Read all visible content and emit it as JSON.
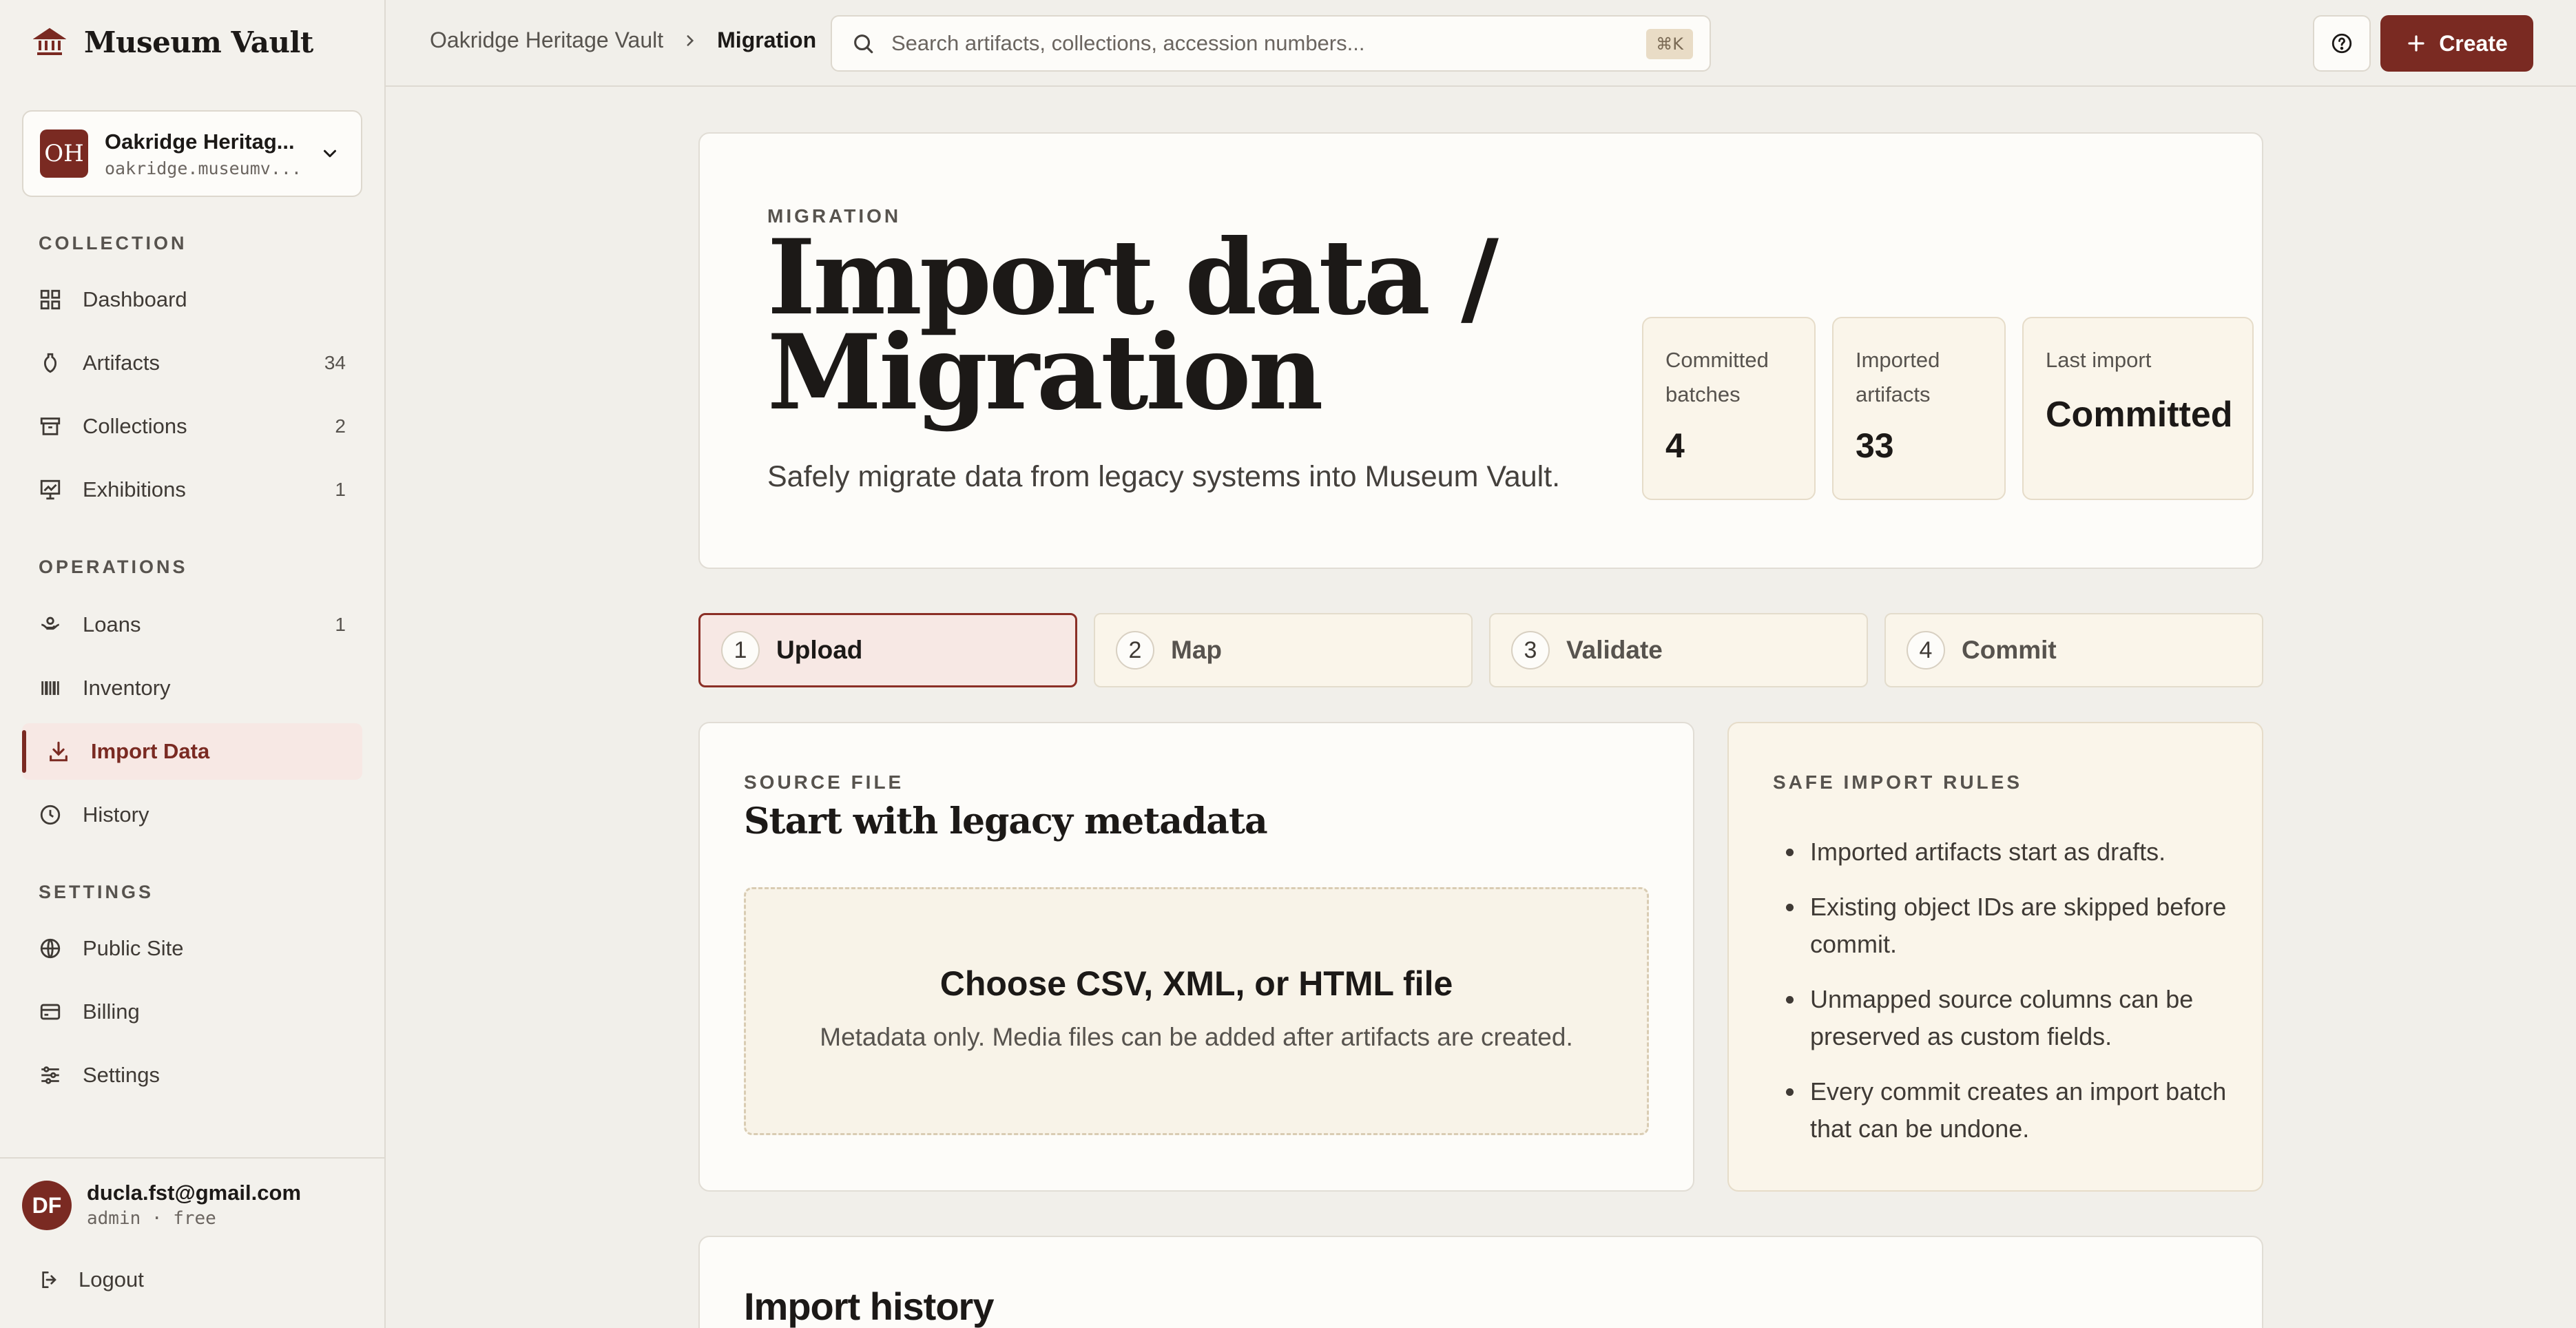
{
  "app": {
    "name": "Museum Vault"
  },
  "org": {
    "initials": "OH",
    "name": "Oakridge Heritag...",
    "domain": "oakridge.museumv..."
  },
  "sidebar": {
    "sections": [
      {
        "title": "COLLECTION"
      },
      {
        "title": "OPERATIONS"
      },
      {
        "title": "SETTINGS"
      }
    ],
    "items": [
      {
        "label": "Dashboard",
        "icon": "grid-icon",
        "count": ""
      },
      {
        "label": "Artifacts",
        "icon": "vase-icon",
        "count": "34"
      },
      {
        "label": "Collections",
        "icon": "archive-box-icon",
        "count": "2"
      },
      {
        "label": "Exhibitions",
        "icon": "presentation-icon",
        "count": "1"
      },
      {
        "label": "Loans",
        "icon": "hand-coin-icon",
        "count": "1"
      },
      {
        "label": "Inventory",
        "icon": "barcode-icon",
        "count": ""
      },
      {
        "label": "Import Data",
        "icon": "download-icon",
        "count": "",
        "active": true
      },
      {
        "label": "History",
        "icon": "clock-icon",
        "count": ""
      },
      {
        "label": "Public Site",
        "icon": "globe-icon",
        "count": ""
      },
      {
        "label": "Billing",
        "icon": "credit-card-icon",
        "count": ""
      },
      {
        "label": "Settings",
        "icon": "sliders-icon",
        "count": ""
      }
    ]
  },
  "user": {
    "initials": "DF",
    "email": "ducla.fst@gmail.com",
    "role": "admin · free",
    "logout_label": "Logout"
  },
  "topbar": {
    "breadcrumb": [
      "Oakridge Heritage Vault",
      "Migration"
    ],
    "search_placeholder": "Search artifacts, collections, accession numbers...",
    "search_shortcut": "⌘K",
    "create_label": "Create"
  },
  "hero": {
    "eyebrow": "MIGRATION",
    "title": "Import data / Migration",
    "subtitle": "Safely migrate data from legacy systems into Museum Vault.",
    "stats": [
      {
        "label": "Committed batches",
        "value": "4"
      },
      {
        "label": "Imported artifacts",
        "value": "33"
      },
      {
        "label": "Last import",
        "value": "Committed"
      }
    ]
  },
  "steps": [
    {
      "num": "1",
      "label": "Upload",
      "active": true
    },
    {
      "num": "2",
      "label": "Map"
    },
    {
      "num": "3",
      "label": "Validate"
    },
    {
      "num": "4",
      "label": "Commit"
    }
  ],
  "source": {
    "eyebrow": "SOURCE FILE",
    "title": "Start with legacy metadata",
    "drop_title": "Choose CSV, XML, or HTML file",
    "drop_sub": "Metadata only. Media files can be added after artifacts are created."
  },
  "rules": {
    "eyebrow": "SAFE IMPORT RULES",
    "items": [
      "Imported artifacts start as drafts.",
      "Existing object IDs are skipped before commit.",
      "Unmapped source columns can be preserved as custom fields.",
      "Every commit creates an import batch that can be undone."
    ]
  },
  "history": {
    "title": "Import history"
  },
  "colors": {
    "accent": "#7a2a22",
    "background": "#f1efea",
    "card": "#fdfcf9",
    "cream": "#faf5ea"
  }
}
